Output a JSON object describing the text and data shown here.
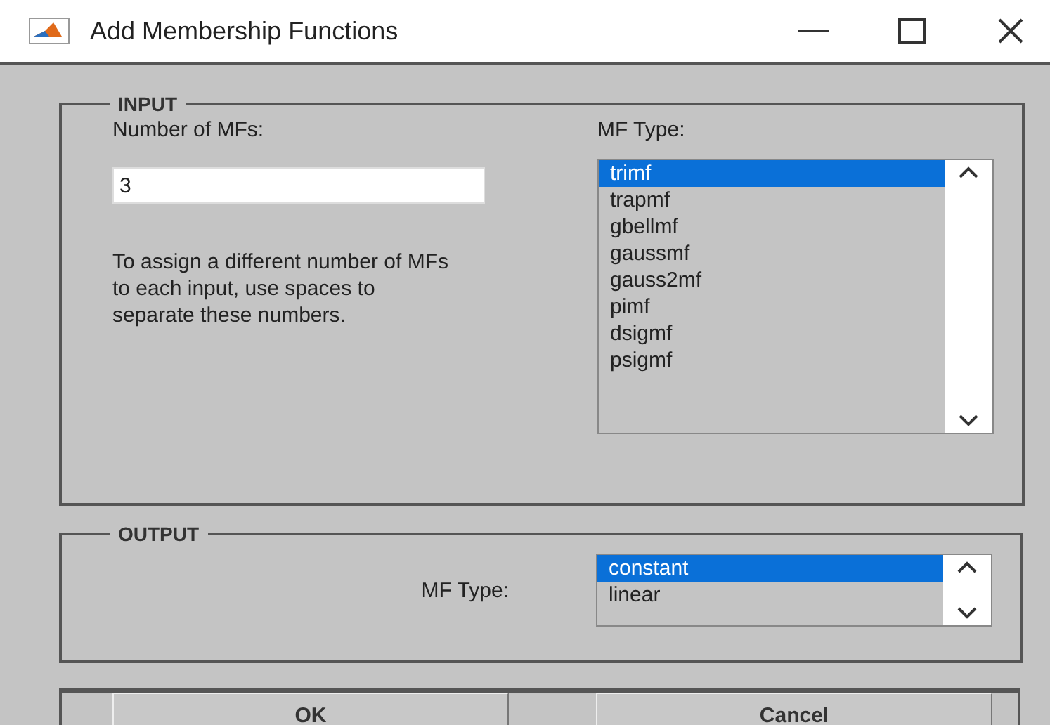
{
  "window": {
    "title": "Add Membership Functions"
  },
  "input": {
    "title": "INPUT",
    "count_label": "Number of MFs:",
    "count_value": "3",
    "help": "To assign a different number of MFs to each input, use spaces to separate these numbers.",
    "type_label": "MF Type:",
    "types": [
      {
        "label": "trimf",
        "selected": true
      },
      {
        "label": "trapmf",
        "selected": false
      },
      {
        "label": "gbellmf",
        "selected": false
      },
      {
        "label": "gaussmf",
        "selected": false
      },
      {
        "label": "gauss2mf",
        "selected": false
      },
      {
        "label": "pimf",
        "selected": false
      },
      {
        "label": "dsigmf",
        "selected": false
      },
      {
        "label": "psigmf",
        "selected": false
      }
    ]
  },
  "output": {
    "title": "OUTPUT",
    "type_label": "MF Type:",
    "types": [
      {
        "label": "constant",
        "selected": true
      },
      {
        "label": "linear",
        "selected": false
      }
    ]
  },
  "buttons": [
    "OK",
    "Cancel"
  ]
}
